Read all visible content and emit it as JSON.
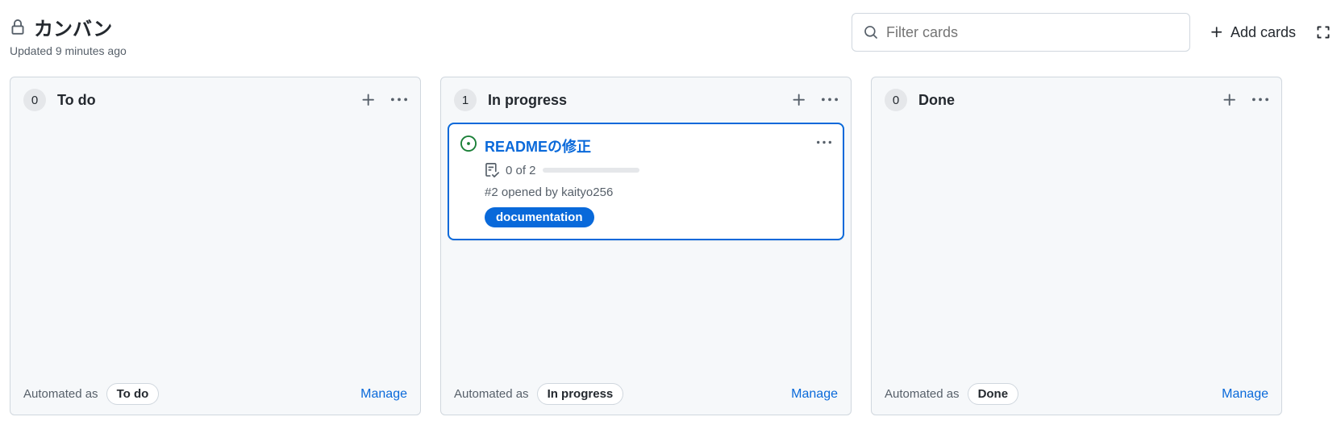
{
  "header": {
    "title": "カンバン",
    "subtitle": "Updated 9 minutes ago",
    "search_placeholder": "Filter cards",
    "add_cards_label": "Add cards"
  },
  "columns": [
    {
      "count": "0",
      "title": "To do",
      "cards": [],
      "automated_label": "Automated as",
      "automated_value": "To do",
      "manage_label": "Manage"
    },
    {
      "count": "1",
      "title": "In progress",
      "cards": [
        {
          "title": "READMEの修正",
          "checklist": "0 of 2",
          "opened": "#2 opened by kaityo256",
          "label": "documentation"
        }
      ],
      "automated_label": "Automated as",
      "automated_value": "In progress",
      "manage_label": "Manage"
    },
    {
      "count": "0",
      "title": "Done",
      "cards": [],
      "automated_label": "Automated as",
      "automated_value": "Done",
      "manage_label": "Manage"
    }
  ]
}
